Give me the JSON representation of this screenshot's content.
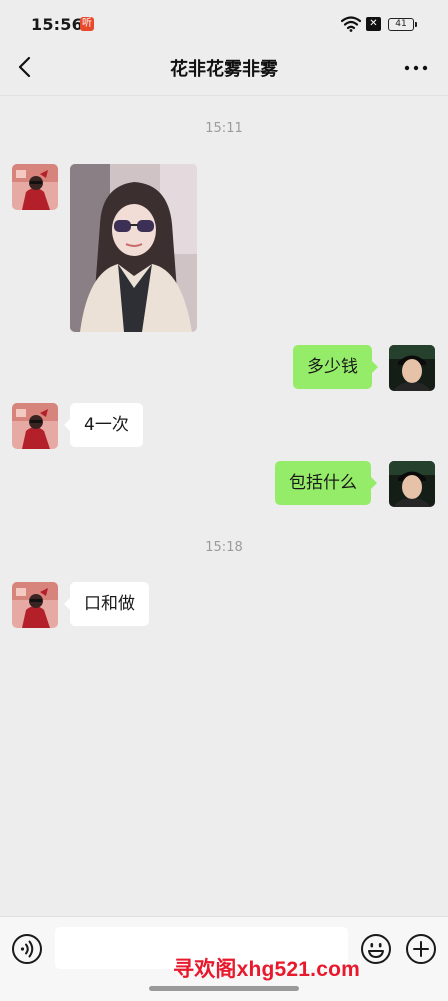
{
  "status_bar": {
    "time": "15:56",
    "app_badge": "听",
    "sim_icon": "sim-off-icon",
    "battery": "41"
  },
  "header": {
    "title": "花非花雾非雾",
    "back_icon": "chevron-left-icon",
    "more_icon": "more-dots-icon"
  },
  "messages": [
    {
      "type": "time",
      "text": "15:11"
    },
    {
      "type": "image",
      "side": "left",
      "sender": "contact",
      "content": "selfie-photo"
    },
    {
      "type": "text",
      "side": "right",
      "sender": "me",
      "text": "多少钱"
    },
    {
      "type": "text",
      "side": "left",
      "sender": "contact",
      "text": "4一次"
    },
    {
      "type": "text",
      "side": "right",
      "sender": "me",
      "text": "包括什么"
    },
    {
      "type": "time",
      "text": "15:18"
    },
    {
      "type": "text",
      "side": "left",
      "sender": "contact",
      "text": "口和做"
    }
  ],
  "input_bar": {
    "voice_icon": "voice-icon",
    "input_value": "",
    "emoji_icon": "emoji-icon",
    "plus_icon": "plus-circle-icon"
  },
  "watermark": "寻欢阁xhg521.com",
  "colors": {
    "background": "#ededed",
    "outgoing_bubble": "#95ec69",
    "incoming_bubble": "#ffffff",
    "timestamp": "#9b9b9b",
    "watermark": "#e8192c"
  }
}
